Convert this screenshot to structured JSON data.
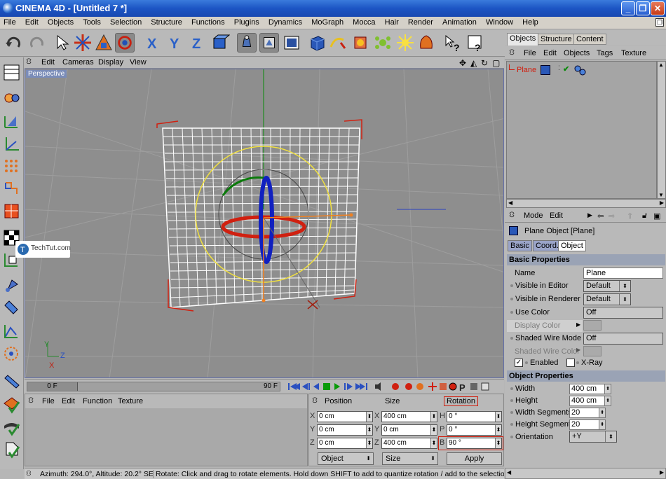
{
  "window": {
    "title": "CINEMA 4D - [Untitled 7 *]"
  },
  "menubar": [
    "File",
    "Edit",
    "Objects",
    "Tools",
    "Selection",
    "Structure",
    "Functions",
    "Plugins",
    "Dynamics",
    "MoGraph",
    "Mocca",
    "Hair",
    "Render",
    "Animation",
    "Window",
    "Help"
  ],
  "viewport": {
    "menu": [
      "Edit",
      "Cameras",
      "Display",
      "View"
    ],
    "label": "Perspective"
  },
  "watermark": "TechTut.com",
  "timeline": {
    "current": "0 F",
    "end": "90 F"
  },
  "materials": {
    "menu": [
      "File",
      "Edit",
      "Function",
      "Texture"
    ]
  },
  "coords": {
    "headers": [
      "Position",
      "Size",
      "Rotation"
    ],
    "rows": [
      {
        "pl": "X",
        "pv": "0 cm",
        "sl": "X",
        "sv": "400 cm",
        "rl": "H",
        "rv": "0 °"
      },
      {
        "pl": "Y",
        "pv": "0 cm",
        "sl": "Y",
        "sv": "0 cm",
        "rl": "P",
        "rv": "0 °"
      },
      {
        "pl": "Z",
        "pv": "0 cm",
        "sl": "Z",
        "sv": "400 cm",
        "rl": "B",
        "rv": "90 °"
      }
    ],
    "mode1": "Object",
    "mode2": "Size",
    "apply": "Apply"
  },
  "status": {
    "left": "Azimuth: 294.0°, Altitude: 20.2° SE",
    "right": "Rotate: Click and drag to rotate elements. Hold down SHIFT to add to quantize rotation / add to the selection in p"
  },
  "objects": {
    "tabs": [
      "Objects",
      "Structure",
      "Content"
    ],
    "menu": [
      "File",
      "Edit",
      "Objects",
      "Tags",
      "Texture"
    ],
    "items": [
      {
        "name": "Plane"
      }
    ]
  },
  "attributes": {
    "menu": [
      "Mode",
      "Edit"
    ],
    "object_title": "Plane Object [Plane]",
    "tabs": [
      "Basic",
      "Coord.",
      "Object"
    ],
    "basic_header": "Basic Properties",
    "basic": [
      {
        "label": "Name",
        "value": "Plane"
      },
      {
        "label": "Visible in Editor",
        "value": "Default"
      },
      {
        "label": "Visible in Renderer",
        "value": "Default"
      },
      {
        "label": "Use Color",
        "value": "Off"
      },
      {
        "label": "Display Color",
        "value": ""
      },
      {
        "label": "Shaded Wire Mode",
        "value": "Off"
      },
      {
        "label": "Shaded Wire Color",
        "value": ""
      }
    ],
    "enabled_label": "Enabled",
    "xray_label": "X-Ray",
    "object_header": "Object Properties",
    "object": [
      {
        "label": "Width",
        "value": "400 cm"
      },
      {
        "label": "Height",
        "value": "400 cm"
      },
      {
        "label": "Width Segments",
        "value": "20"
      },
      {
        "label": "Height Segments",
        "value": "20"
      },
      {
        "label": "Orientation",
        "value": "+Y"
      }
    ]
  }
}
